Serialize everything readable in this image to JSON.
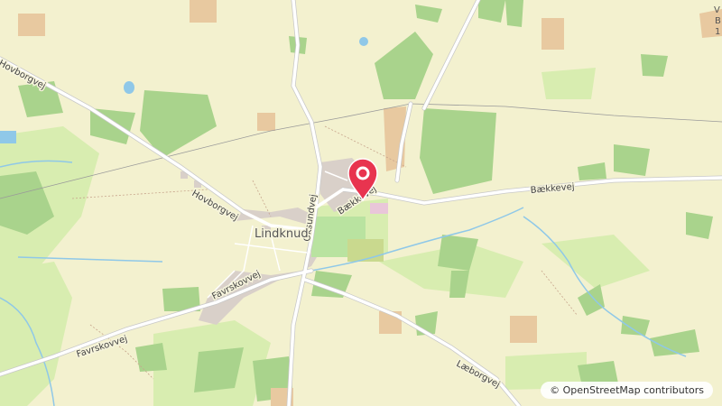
{
  "map": {
    "place_name": "Lindknud",
    "marker_icon": "map-pin-icon",
    "marker_color": "#e8344f",
    "roads": {
      "hovborgvej": "Hovborgvej",
      "oksdundvej": "Oksundvej",
      "baekkevej_upper": "Bækkevej",
      "baekkevej_lower": "Bækkevej",
      "favrskovvej_upper": "Favrskovvej",
      "favrskovvej_lower": "Favrskovvej",
      "laeborgvej": "Læborgvej",
      "other_road": "Favrskovvej"
    },
    "edge_fragments": [
      "V",
      "B",
      "1"
    ],
    "attribution": "© OpenStreetMap contributors",
    "colors": {
      "land": "#f3f1cf",
      "forest": "#a9d38c",
      "meadow": "#d8edb0",
      "water": "#8fc8e8",
      "road": "#ffffff",
      "building": "#d9d0c9",
      "farm": "#e8c9a0"
    }
  }
}
